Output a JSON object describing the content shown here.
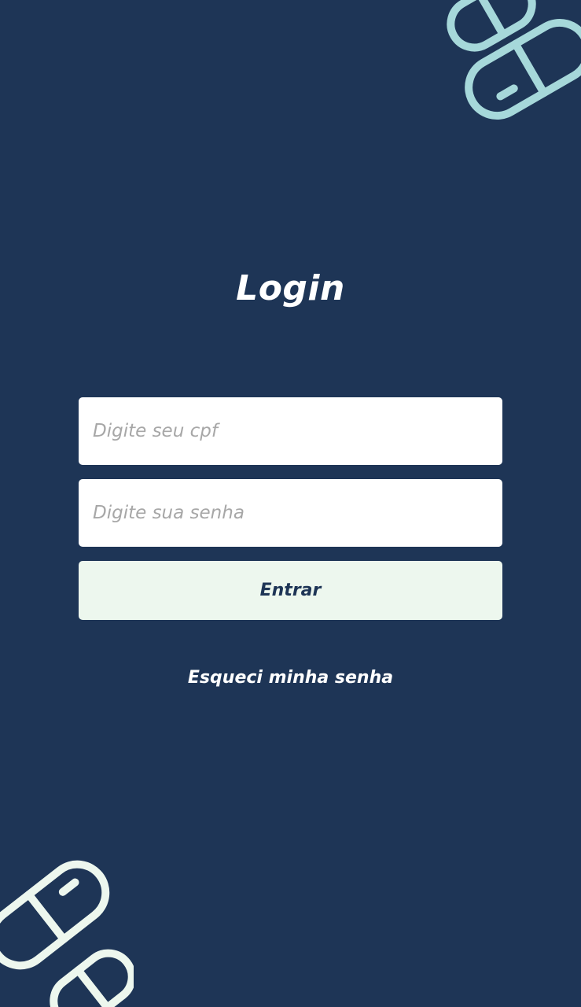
{
  "colors": {
    "background": "#1e3556",
    "button_background": "#edf7ee",
    "button_text": "#1e3556",
    "placeholder_text": "#a7a7a7",
    "top_pill_color": "#a6d8da",
    "bottom_pill_color": "#edf7ee"
  },
  "decorations": {
    "top_right": "pill-capsule-icon",
    "bottom_left": "pill-capsule-icon"
  },
  "login": {
    "title": "Login",
    "cpf_placeholder": "Digite seu cpf",
    "cpf_value": "",
    "password_placeholder": "Digite sua senha",
    "password_value": "",
    "submit_label": "Entrar",
    "forgot_password_label": "Esqueci minha senha"
  }
}
